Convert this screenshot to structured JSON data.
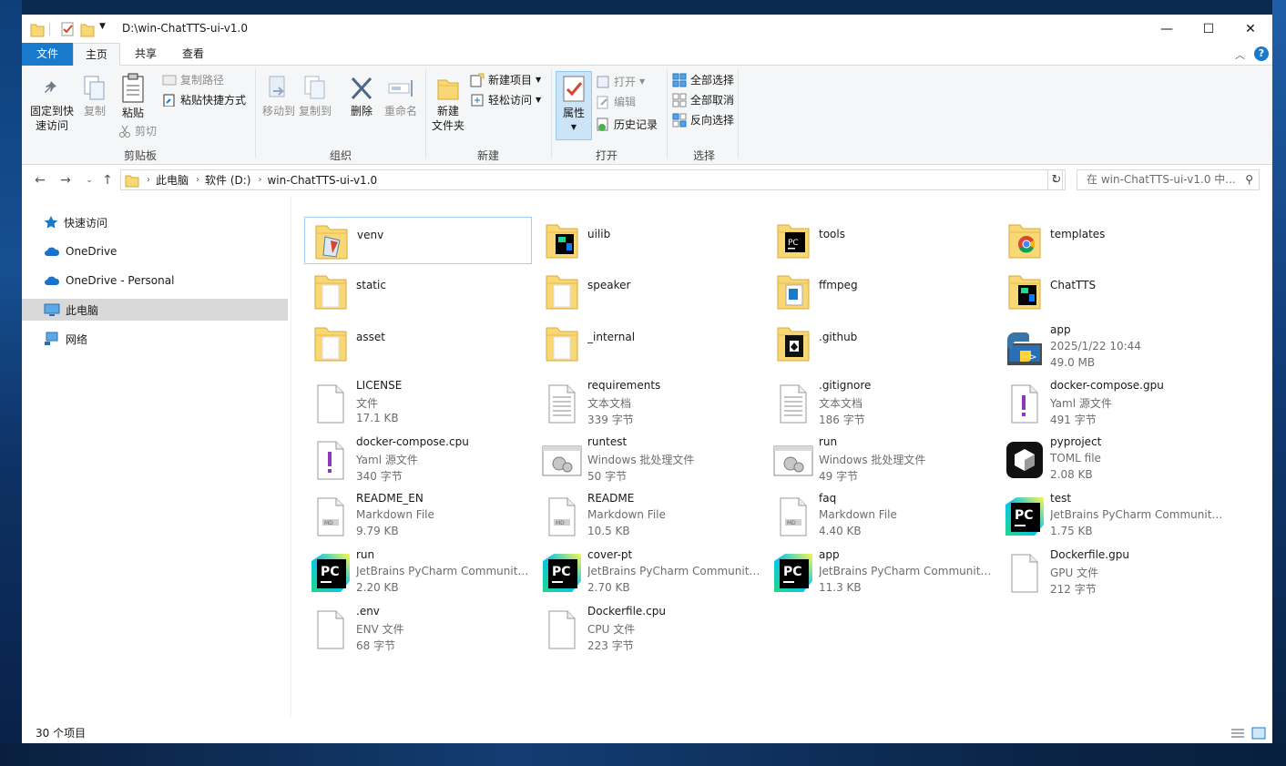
{
  "window": {
    "title": "D:\\win-ChatTTS-ui-v1.0",
    "controls": {
      "minimize": "—",
      "maximize": "☐",
      "close": "✕"
    }
  },
  "tabs": [
    "文件",
    "主页",
    "共享",
    "查看"
  ],
  "ribbon": {
    "clipboard": {
      "pin": "固定到快速访问",
      "pin_l1": "固定到快",
      "pin_l2": "速访问",
      "copy": "复制",
      "paste": "粘贴",
      "copy_path": "复制路径",
      "paste_shortcut": "粘贴快捷方式",
      "cut": "剪切",
      "label": "剪贴板"
    },
    "organize": {
      "move_to": "移动到",
      "copy_to": "复制到",
      "delete": "删除",
      "rename": "重命名",
      "label": "组织"
    },
    "new": {
      "new_folder_l1": "新建",
      "new_folder_l2": "文件夹",
      "new_item": "新建项目",
      "easy_access": "轻松访问",
      "label": "新建"
    },
    "open": {
      "properties": "属性",
      "open": "打开",
      "edit": "编辑",
      "history": "历史记录",
      "label": "打开"
    },
    "select": {
      "select_all": "全部选择",
      "select_none": "全部取消",
      "invert": "反向选择",
      "label": "选择"
    }
  },
  "address": {
    "crumbs": [
      "此电脑",
      "软件 (D:)",
      "win-ChatTTS-ui-v1.0"
    ],
    "search_placeholder": "在 win-ChatTTS-ui-v1.0 中..."
  },
  "sidebar": {
    "items": [
      {
        "label": "快速访问",
        "icon": "star-icon"
      },
      {
        "label": "OneDrive",
        "icon": "cloud-icon"
      },
      {
        "label": "OneDrive - Personal",
        "icon": "cloud-icon"
      },
      {
        "label": "此电脑",
        "icon": "computer-icon",
        "selected": true
      },
      {
        "label": "网络",
        "icon": "network-icon"
      }
    ]
  },
  "files": [
    {
      "name": "venv",
      "icon": "folder-venv"
    },
    {
      "name": "uilib",
      "icon": "folder-uilib"
    },
    {
      "name": "tools",
      "icon": "folder-pycharm"
    },
    {
      "name": "templates",
      "icon": "folder-chrome"
    },
    {
      "name": "static",
      "icon": "folder"
    },
    {
      "name": "speaker",
      "icon": "folder"
    },
    {
      "name": "ffmpeg",
      "icon": "folder-ffmpeg"
    },
    {
      "name": "ChatTTS",
      "icon": "folder-uilib"
    },
    {
      "name": "asset",
      "icon": "folder"
    },
    {
      "name": "_internal",
      "icon": "folder"
    },
    {
      "name": ".github",
      "icon": "folder-github"
    },
    {
      "name": "app",
      "type": "2025/1/22 10:44",
      "size": "49.0 MB",
      "icon": "python-exe"
    },
    {
      "name": "LICENSE",
      "type": "文件",
      "size": "17.1 KB",
      "icon": "blank"
    },
    {
      "name": "requirements",
      "type": "文本文档",
      "size": "339 字节",
      "icon": "text"
    },
    {
      "name": ".gitignore",
      "type": "文本文档",
      "size": "186 字节",
      "icon": "text"
    },
    {
      "name": "docker-compose.gpu",
      "type": "Yaml 源文件",
      "size": "491 字节",
      "icon": "yaml"
    },
    {
      "name": "docker-compose.cpu",
      "type": "Yaml 源文件",
      "size": "340 字节",
      "icon": "yaml"
    },
    {
      "name": "runtest",
      "type": "Windows 批处理文件",
      "size": "50 字节",
      "icon": "batch"
    },
    {
      "name": "run",
      "type": "Windows 批处理文件",
      "size": "49 字节",
      "icon": "batch"
    },
    {
      "name": "pyproject",
      "type": "TOML file",
      "size": "2.08 KB",
      "icon": "toml"
    },
    {
      "name": "README_EN",
      "type": "Markdown File",
      "size": "9.79 KB",
      "icon": "md"
    },
    {
      "name": "README",
      "type": "Markdown File",
      "size": "10.5 KB",
      "icon": "md"
    },
    {
      "name": "faq",
      "type": "Markdown File",
      "size": "4.40 KB",
      "icon": "md"
    },
    {
      "name": "test",
      "type": "JetBrains PyCharm Community...",
      "size": "1.75 KB",
      "icon": "pycharm"
    },
    {
      "name": "run",
      "type": "JetBrains PyCharm Community...",
      "size": "2.20 KB",
      "icon": "pycharm"
    },
    {
      "name": "cover-pt",
      "type": "JetBrains PyCharm Community...",
      "size": "2.70 KB",
      "icon": "pycharm"
    },
    {
      "name": "app",
      "type": "JetBrains PyCharm Community...",
      "size": "11.3 KB",
      "icon": "pycharm"
    },
    {
      "name": "Dockerfile.gpu",
      "type": "GPU 文件",
      "size": "212 字节",
      "icon": "blank"
    },
    {
      "name": ".env",
      "type": "ENV 文件",
      "size": "68 字节",
      "icon": "blank"
    },
    {
      "name": "Dockerfile.cpu",
      "type": "CPU 文件",
      "size": "223 字节",
      "icon": "blank"
    }
  ],
  "status": {
    "count": "30 个项目"
  },
  "colors": {
    "accent": "#1979ca",
    "folder": "#f8d775",
    "ribbon_bg": "#f5f6f7"
  }
}
